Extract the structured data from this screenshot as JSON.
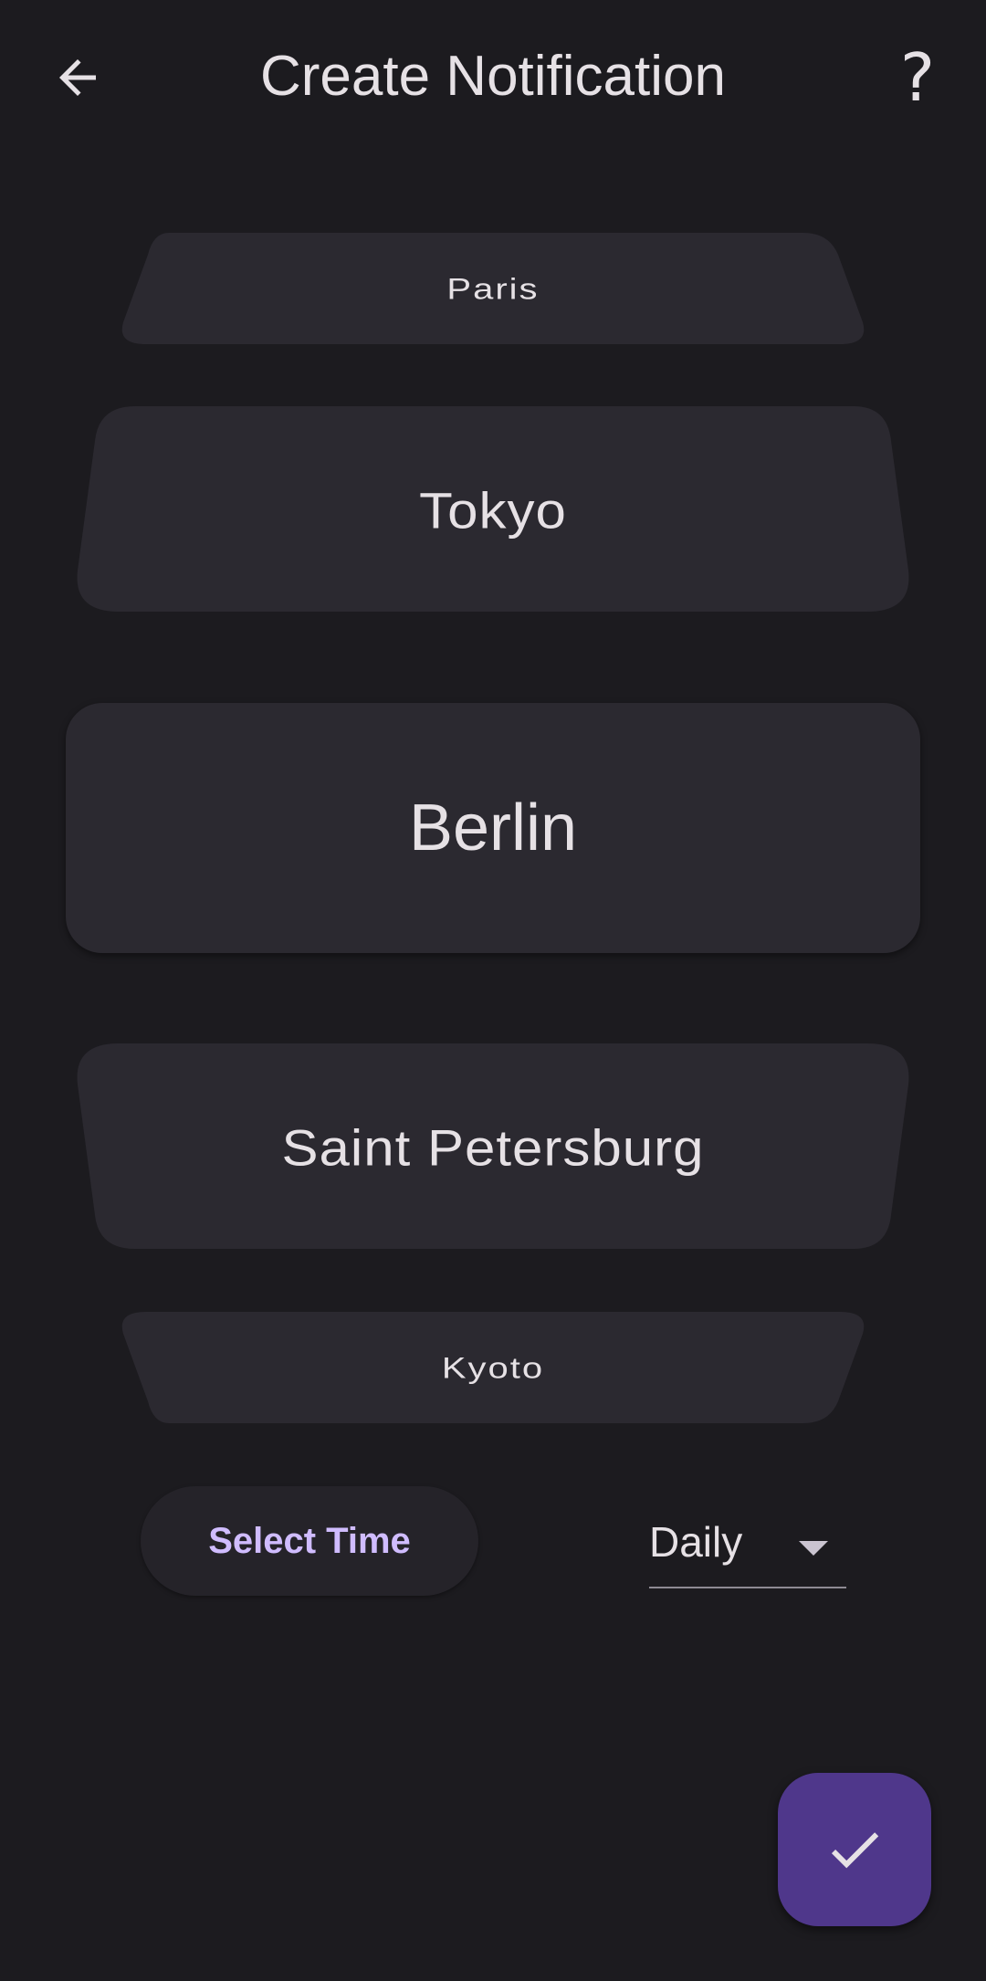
{
  "header": {
    "title": "Create Notification",
    "back_icon": "arrow-back-icon",
    "help_label": "?"
  },
  "wheel": {
    "items": [
      {
        "label": "Paris"
      },
      {
        "label": "Tokyo"
      },
      {
        "label": "Berlin"
      },
      {
        "label": "Saint Petersburg"
      },
      {
        "label": "Kyoto"
      }
    ],
    "selected": "Berlin"
  },
  "controls": {
    "select_time_label": "Select Time",
    "frequency_value": "Daily",
    "frequency_icon": "dropdown-arrow-icon"
  },
  "fab": {
    "icon": "check-icon"
  },
  "colors": {
    "background": "#1c1b1f",
    "card": "#2b2930",
    "accent_text": "#d0bcff",
    "fab": "#4f378b"
  }
}
